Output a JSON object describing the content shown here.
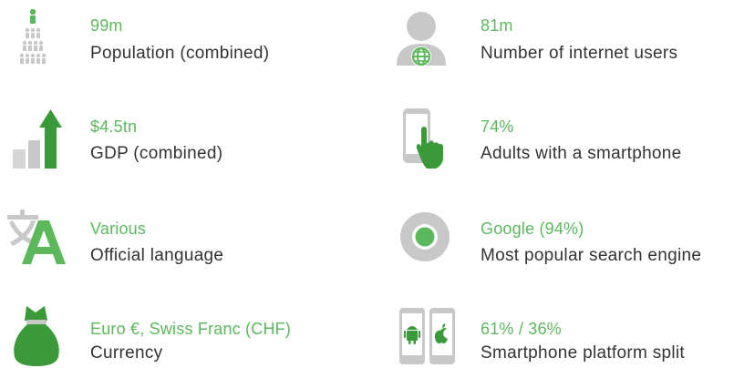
{
  "colors": {
    "accent": "#5cb85c",
    "accent_dark": "#3a9a3a",
    "icon_grey": "#c8c8c8",
    "label_text": "#333333"
  },
  "stats": [
    {
      "value": "99m",
      "label": "Population (combined)",
      "icon": "population-icon"
    },
    {
      "value": "81m",
      "label": "Number of internet users",
      "icon": "internet-users-icon"
    },
    {
      "value": "$4.5tn",
      "label": "GDP (combined)",
      "icon": "gdp-chart-icon"
    },
    {
      "value": "74%",
      "label": "Adults with a smartphone",
      "icon": "smartphone-touch-icon"
    },
    {
      "value": "Various",
      "label": "Official language",
      "icon": "translate-icon"
    },
    {
      "value": "Google (94%)",
      "label": "Most popular search engine",
      "icon": "chrome-icon"
    },
    {
      "value": "Euro €, Swiss Franc (CHF)",
      "label": "Currency",
      "icon": "money-bag-icon"
    },
    {
      "value": "61% / 36%",
      "label": "Smartphone platform split",
      "icon": "platform-split-icon"
    }
  ]
}
